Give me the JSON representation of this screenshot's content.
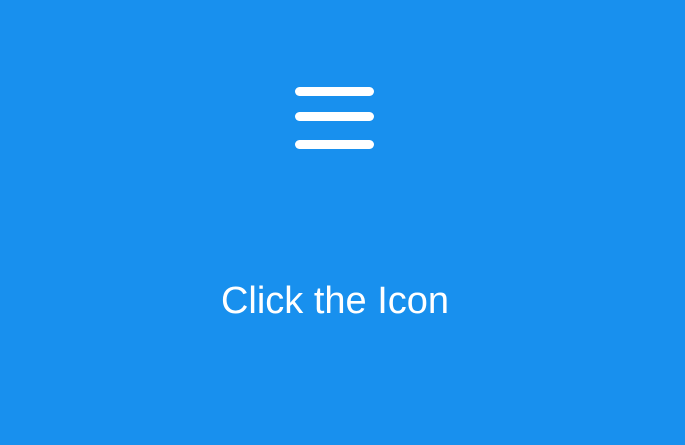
{
  "app": {
    "background_color": "#1890EE",
    "foreground_color": "#FFFFFF"
  },
  "menu": {
    "icon": "hamburger-menu-icon"
  },
  "caption": {
    "text": "Click the Icon"
  }
}
